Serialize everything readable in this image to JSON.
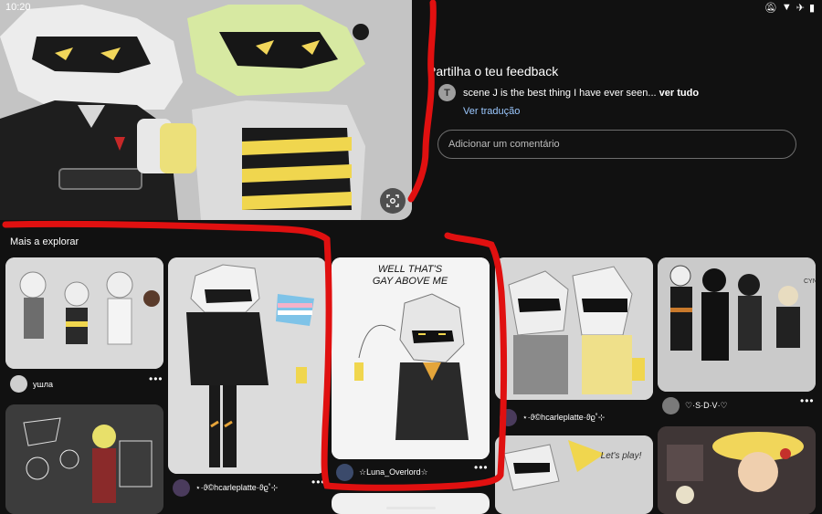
{
  "status_bar": {
    "time": "10:20",
    "icons": [
      "bell-off-icon",
      "wifi-icon",
      "airplane-icon",
      "battery-icon"
    ]
  },
  "feedback": {
    "title": "Partilha o teu feedback",
    "comment_avatar_letter": "T",
    "comment_text": "scene J is the best thing I have ever seen...",
    "comment_more": "ver tudo",
    "translate_label": "Ver tradução",
    "input_placeholder": "Adicionar um comentário"
  },
  "explore": {
    "title": "Mais a explorar",
    "pins": [
      {
        "user": "ушла"
      },
      {
        "user": "⋆·ϑ©hcarleplatte·ϑϱ˚⊹"
      },
      {
        "user": "☆Luna_Overlord☆",
        "caption_line1": "WELL THAT'S",
        "caption_line2": "GAY ABOVE ME"
      },
      {
        "user": "⋆·ϑ©hcarleplatte·ϑϱ˚⊹"
      },
      {
        "user": "♡·S·D·V·♡"
      },
      {
        "handwriting": "Let's play!"
      }
    ]
  },
  "colors": {
    "background": "#111111",
    "link": "#9bc8ff",
    "annotation_red": "#e01010"
  }
}
